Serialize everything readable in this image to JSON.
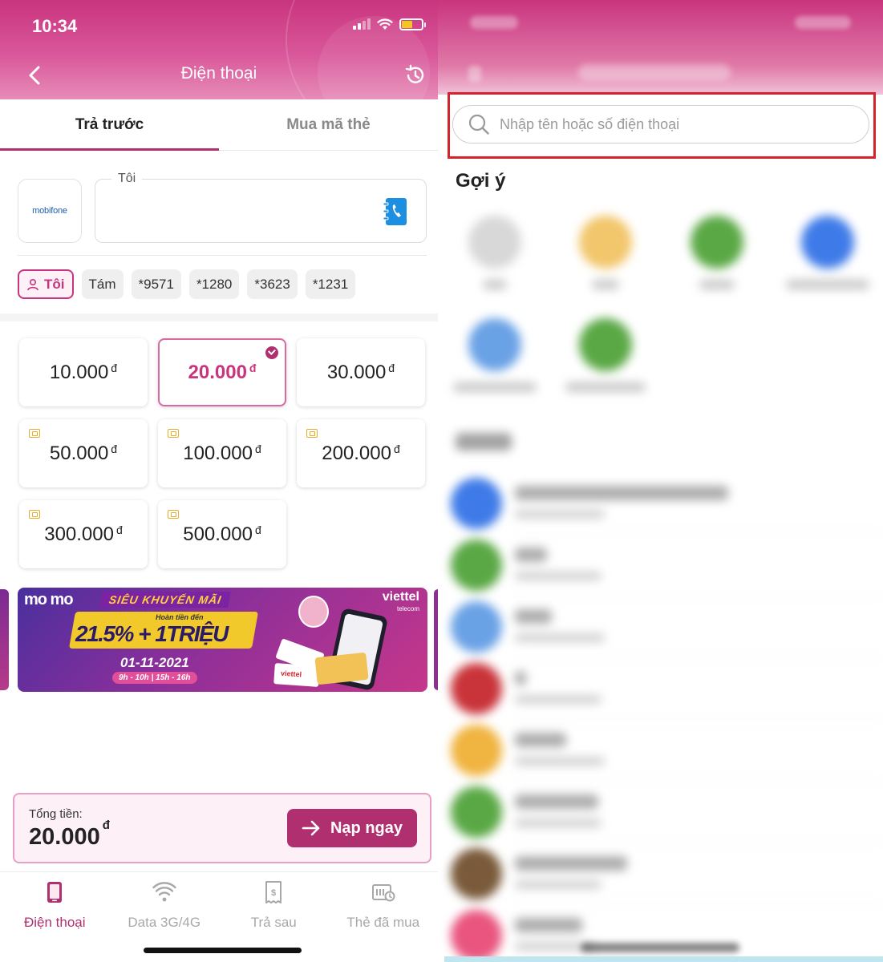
{
  "left": {
    "status_bar": {
      "time": "10:34"
    },
    "header": {
      "title": "Điện thoại"
    },
    "tabs": [
      {
        "label": "Trả trước",
        "active": true
      },
      {
        "label": "Mua mã thẻ",
        "active": false
      }
    ],
    "carrier": {
      "logo_text": "mobifone"
    },
    "phone_input": {
      "label": "Tôi",
      "value": ""
    },
    "contact_chips": [
      {
        "label": "Tôi",
        "selected": true
      },
      {
        "label": "Tám"
      },
      {
        "label": "*9571"
      },
      {
        "label": "*1280"
      },
      {
        "label": "*3623"
      },
      {
        "label": "*1231"
      }
    ],
    "currency_symbol": "đ",
    "amounts": [
      {
        "value": "10.000",
        "selected": false,
        "voucher": false
      },
      {
        "value": "20.000",
        "selected": true,
        "voucher": false
      },
      {
        "value": "30.000",
        "selected": false,
        "voucher": false
      },
      {
        "value": "50.000",
        "selected": false,
        "voucher": true
      },
      {
        "value": "100.000",
        "selected": false,
        "voucher": true
      },
      {
        "value": "200.000",
        "selected": false,
        "voucher": true
      },
      {
        "value": "300.000",
        "selected": false,
        "voucher": true
      },
      {
        "value": "500.000",
        "selected": false,
        "voucher": true
      }
    ],
    "banner": {
      "brand": "mo mo",
      "partner": "viettel",
      "partner_sub": "telecom",
      "headline": "SIÊU KHUYẾN MÃI",
      "sub": "Hoàn tiền đến",
      "main": "21.5% + 1TRIỆU",
      "date": "01-11-2021",
      "hours": "9h - 10h | 15h - 16h",
      "card_brand": "viettel"
    },
    "total": {
      "label": "Tổng tiền:",
      "value": "20.000"
    },
    "cta_label": "Nạp ngay",
    "bottom_nav": [
      {
        "label": "Điện thoại",
        "icon": "phone-icon",
        "active": true
      },
      {
        "label": "Data 3G/4G",
        "icon": "wifi-icon",
        "active": false
      },
      {
        "label": "Trả sau",
        "icon": "bill-icon",
        "active": false
      },
      {
        "label": "Thẻ đã mua",
        "icon": "purchased-cards-icon",
        "active": false
      }
    ],
    "colors": {
      "primary": "#b0306f",
      "header_pink": "#c9347f",
      "highlight_red": "#d3242c"
    }
  },
  "right": {
    "search": {
      "placeholder": "Nhập tên hoặc số điện thoại",
      "value": ""
    },
    "suggestions_title": "Gợi ý",
    "suggestion_avatar_colors": [
      "#d8d8d8",
      "#f2c66b",
      "#5aa845",
      "#3f7be8",
      "#6aa2e6",
      "#5aa845"
    ],
    "contact_avatar_colors": [
      "#3f7be8",
      "#5aa845",
      "#6aa2e6",
      "#c9343a",
      "#f0b440",
      "#5aa845",
      "#7a5a3a",
      "#e9557f"
    ]
  }
}
